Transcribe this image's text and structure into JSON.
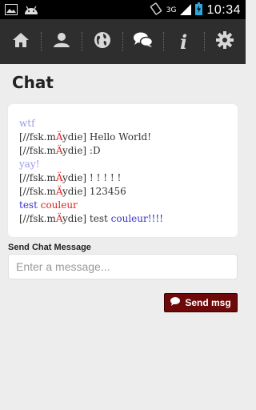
{
  "status_bar": {
    "network_type": "3G",
    "time": "10:34"
  },
  "nav": {
    "items": [
      {
        "icon": "home-icon"
      },
      {
        "icon": "user-icon"
      },
      {
        "icon": "globe-icon"
      },
      {
        "icon": "chat-bubbles-icon"
      },
      {
        "icon": "info-icon"
      },
      {
        "icon": "gear-icon"
      }
    ],
    "info_glyph": "i"
  },
  "page": {
    "title": "Chat"
  },
  "chat": {
    "messages": [
      {
        "segments": [
          {
            "text": "wtf",
            "color": "lavender"
          }
        ]
      },
      {
        "segments": [
          {
            "text": "[//fsk.m",
            "color": "default"
          },
          {
            "text": "Ä",
            "color": "red"
          },
          {
            "text": "ydie] Hello World!",
            "color": "default"
          }
        ]
      },
      {
        "segments": [
          {
            "text": "[//fsk.m",
            "color": "default"
          },
          {
            "text": "Ä",
            "color": "red"
          },
          {
            "text": "ydie] :D",
            "color": "default"
          }
        ]
      },
      {
        "segments": [
          {
            "text": "yay!",
            "color": "lavender"
          }
        ]
      },
      {
        "segments": [
          {
            "text": "[//fsk.m",
            "color": "default"
          },
          {
            "text": "Ä",
            "color": "red"
          },
          {
            "text": "ydie] ! ! ! ! !",
            "color": "default"
          }
        ]
      },
      {
        "segments": [
          {
            "text": "[//fsk.m",
            "color": "default"
          },
          {
            "text": "Ä",
            "color": "red"
          },
          {
            "text": "ydie] 123456",
            "color": "default"
          }
        ]
      },
      {
        "segments": [
          {
            "text": "test ",
            "color": "blue"
          },
          {
            "text": "couleur",
            "color": "red"
          }
        ]
      },
      {
        "segments": [
          {
            "text": "[//fsk.m",
            "color": "default"
          },
          {
            "text": "Ä",
            "color": "red"
          },
          {
            "text": "ydie] test ",
            "color": "default"
          },
          {
            "text": "couleur!!!!",
            "color": "blue"
          }
        ]
      }
    ]
  },
  "send": {
    "label": "Send Chat Message",
    "placeholder": "Enter a message...",
    "button_label": "Send msg"
  },
  "colors": {
    "accent_button": "#6d0909",
    "navbar": "#2e2e2e",
    "lavender": "#9a9ae6",
    "blue": "#3333cc",
    "red": "#dd2222"
  }
}
